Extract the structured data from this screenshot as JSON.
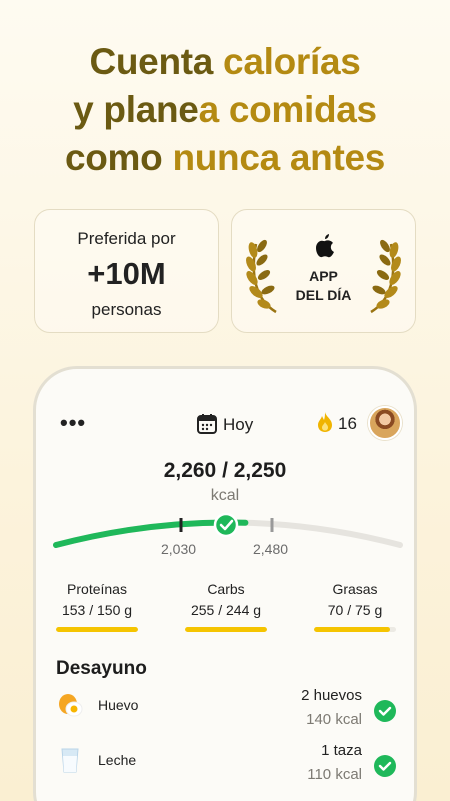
{
  "headline": {
    "line1_a": "Cuenta ",
    "line1_b": "calorías",
    "line2_a": "y plane",
    "line2_b": "a comidas",
    "line3_a": "como ",
    "line3_b": "nunca antes"
  },
  "badge_users": {
    "top": "Preferida por",
    "big": "+10M",
    "bottom": "personas"
  },
  "badge_award": {
    "line1": "APP",
    "line2": "DEL DÍA",
    "icon": "apple-logo"
  },
  "header": {
    "menu_icon": "more-dots",
    "date_label": "Hoy",
    "streak_count": "16",
    "streak_icon": "flame"
  },
  "calories": {
    "consumed_vs_goal": "2,260 / 2,250",
    "unit": "kcal",
    "low_mark": "2,030",
    "high_mark": "2,480",
    "progress": 0.55
  },
  "macros": [
    {
      "name": "Proteínas",
      "value": "153 / 150 g",
      "fill": 1.0
    },
    {
      "name": "Carbs",
      "value": "255 / 244 g",
      "fill": 1.0
    },
    {
      "name": "Grasas",
      "value": "70 / 75 g",
      "fill": 0.93
    }
  ],
  "meal": {
    "title": "Desayuno",
    "items": [
      {
        "name": "Huevo",
        "qty": "2 huevos",
        "kcal": "140 kcal",
        "icon": "egg"
      },
      {
        "name": "Leche",
        "qty": "1 taza",
        "kcal": "110 kcal",
        "icon": "glass-of-milk"
      }
    ]
  },
  "colors": {
    "accent_green": "#1fb85a",
    "macro_yellow": "#f5c400",
    "headline_gold": "#b48a12",
    "headline_dark": "#6b5a12"
  }
}
